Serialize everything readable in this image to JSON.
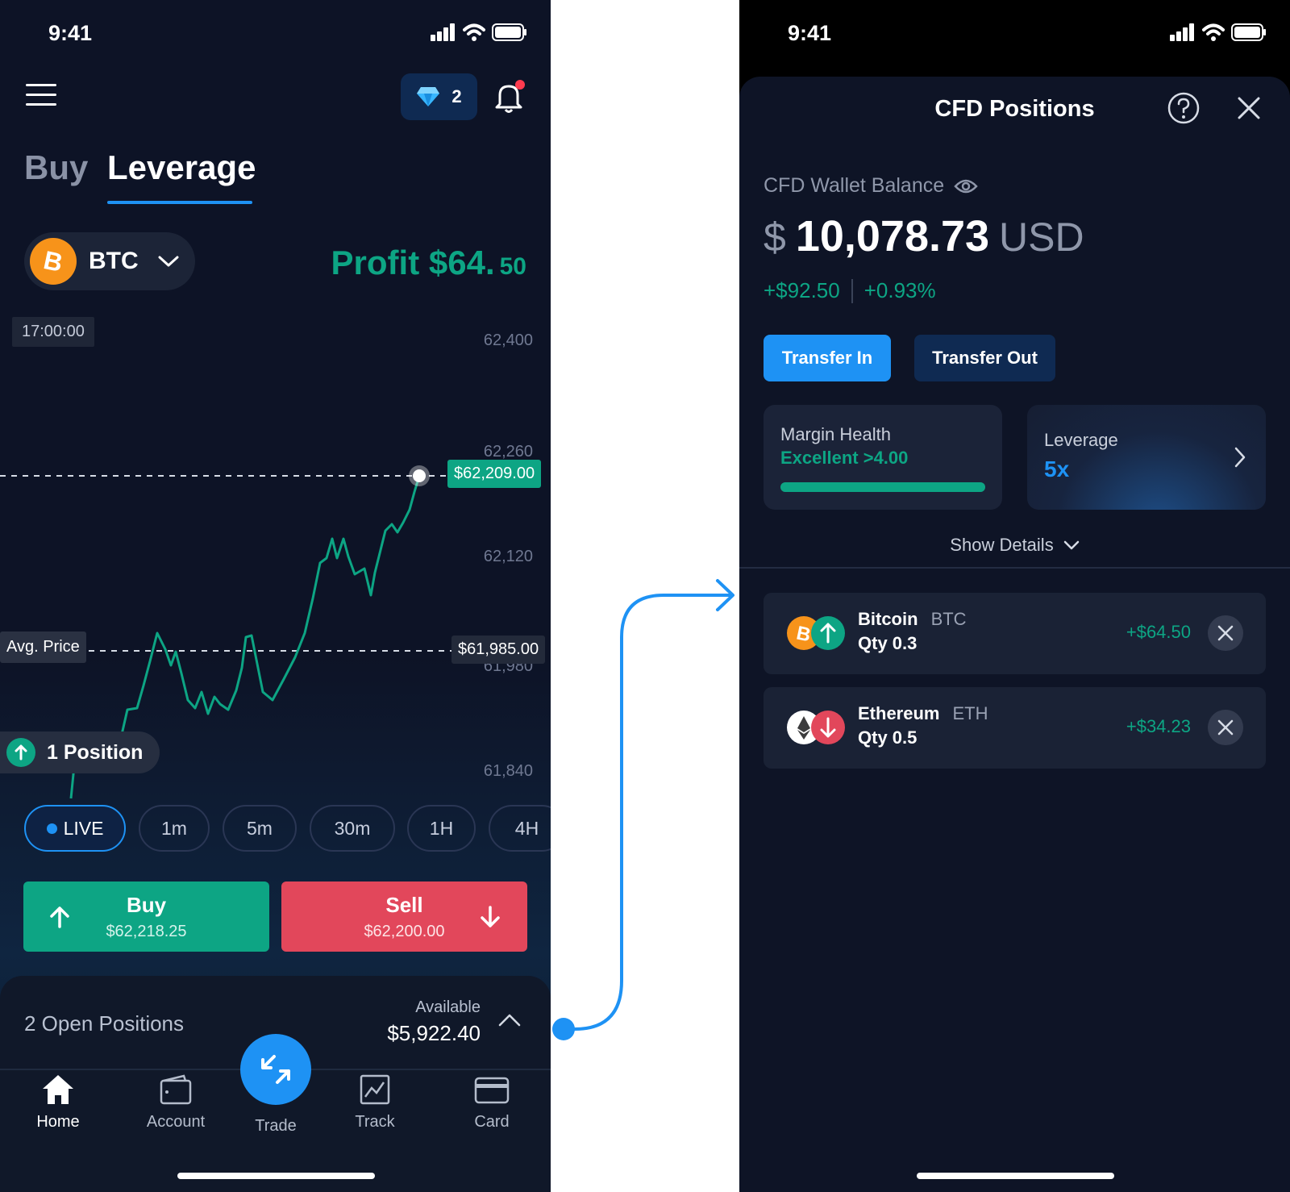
{
  "left": {
    "status_time": "9:41",
    "gems_count": "2",
    "tabs": {
      "buy": "Buy",
      "leverage": "Leverage"
    },
    "asset": {
      "symbol": "BTC",
      "icon": "bitcoin-icon"
    },
    "profit": {
      "label": "Profit $64.",
      "cents": "50"
    },
    "chart": {
      "time_label": "17:00:00",
      "y_ticks": [
        "62,400",
        "62,260",
        "62,120",
        "61,980",
        "61,840"
      ],
      "current_price": "$62,209.00",
      "avg_label": "Avg. Price",
      "avg_price": "$61,985.00",
      "positions_badge": "1 Position"
    },
    "ranges": [
      "LIVE",
      "1m",
      "5m",
      "30m",
      "1H",
      "4H"
    ],
    "buy": {
      "label": "Buy",
      "price": "$62,218.25"
    },
    "sell": {
      "label": "Sell",
      "price": "$62,200.00"
    },
    "open_positions": "2 Open Positions",
    "available": {
      "label": "Available",
      "value": "$5,922.40"
    },
    "nav": {
      "home": "Home",
      "account": "Account",
      "trade": "Trade",
      "track": "Track",
      "card": "Card"
    },
    "colors": {
      "green": "#0da584",
      "red": "#e2475b",
      "blue": "#1e92f4"
    }
  },
  "right": {
    "status_time": "9:41",
    "title": "CFD Positions",
    "balance_label": "CFD Wallet Balance",
    "balance": {
      "currency_symbol": "$",
      "amount": "10,078.73",
      "unit": "USD"
    },
    "change": {
      "abs": "+$92.50",
      "pct": "+0.93%"
    },
    "transfer_in": "Transfer In",
    "transfer_out": "Transfer Out",
    "margin": {
      "label": "Margin Health",
      "value": "Excellent >4.00",
      "level": 1.0
    },
    "leverage": {
      "label": "Leverage",
      "value": "5x"
    },
    "show_details": "Show Details",
    "positions": [
      {
        "name": "Bitcoin",
        "ticker": "BTC",
        "qty": "Qty 0.3",
        "pnl": "+$64.50",
        "direction": "up"
      },
      {
        "name": "Ethereum",
        "ticker": "ETH",
        "qty": "Qty 0.5",
        "pnl": "+$34.23",
        "direction": "down"
      }
    ]
  }
}
